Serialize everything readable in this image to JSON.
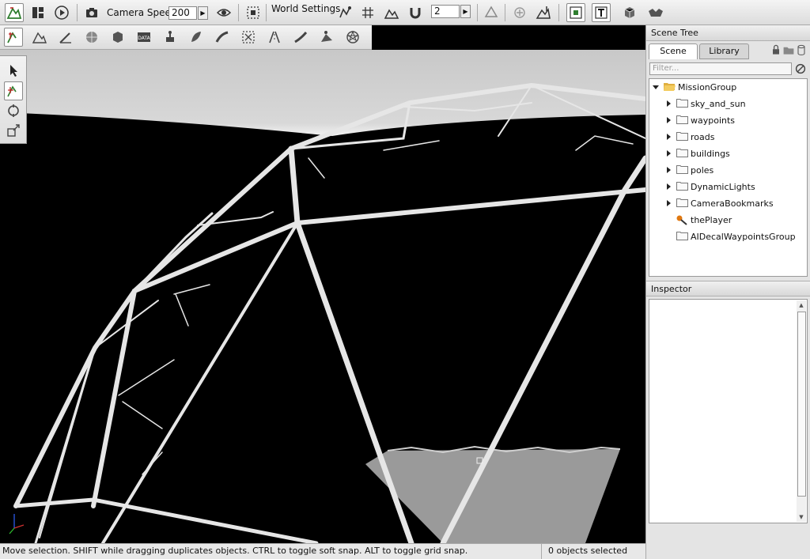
{
  "toolbar": {
    "camera_speed_label": "Camera Speed",
    "camera_speed_value": "200",
    "world_settings_label": "World Settings",
    "snap_value": "2"
  },
  "status": {
    "hint": "Move selection.  SHIFT while dragging duplicates objects.  CTRL to toggle soft snap.  ALT to toggle grid snap.",
    "selection": "0 objects selected"
  },
  "scene_tree": {
    "title": "Scene Tree",
    "tabs": [
      "Scene",
      "Library"
    ],
    "filter_placeholder": "Filter...",
    "root": "MissionGroup",
    "items": [
      {
        "label": "sky_and_sun",
        "type": "folder"
      },
      {
        "label": "waypoints",
        "type": "folder"
      },
      {
        "label": "roads",
        "type": "folder"
      },
      {
        "label": "buildings",
        "type": "folder"
      },
      {
        "label": "poles",
        "type": "folder"
      },
      {
        "label": "DynamicLights",
        "type": "folder"
      },
      {
        "label": "CameraBookmarks",
        "type": "folder"
      },
      {
        "label": "thePlayer",
        "type": "player"
      },
      {
        "label": "AIDecalWaypointsGroup",
        "type": "group"
      }
    ]
  },
  "inspector": {
    "title": "Inspector"
  },
  "colors": {
    "sky": "#bdbdbd",
    "wire": "#e6e6e6",
    "ground": "#9a9a9a",
    "accent_green": "#3a9a3a"
  }
}
